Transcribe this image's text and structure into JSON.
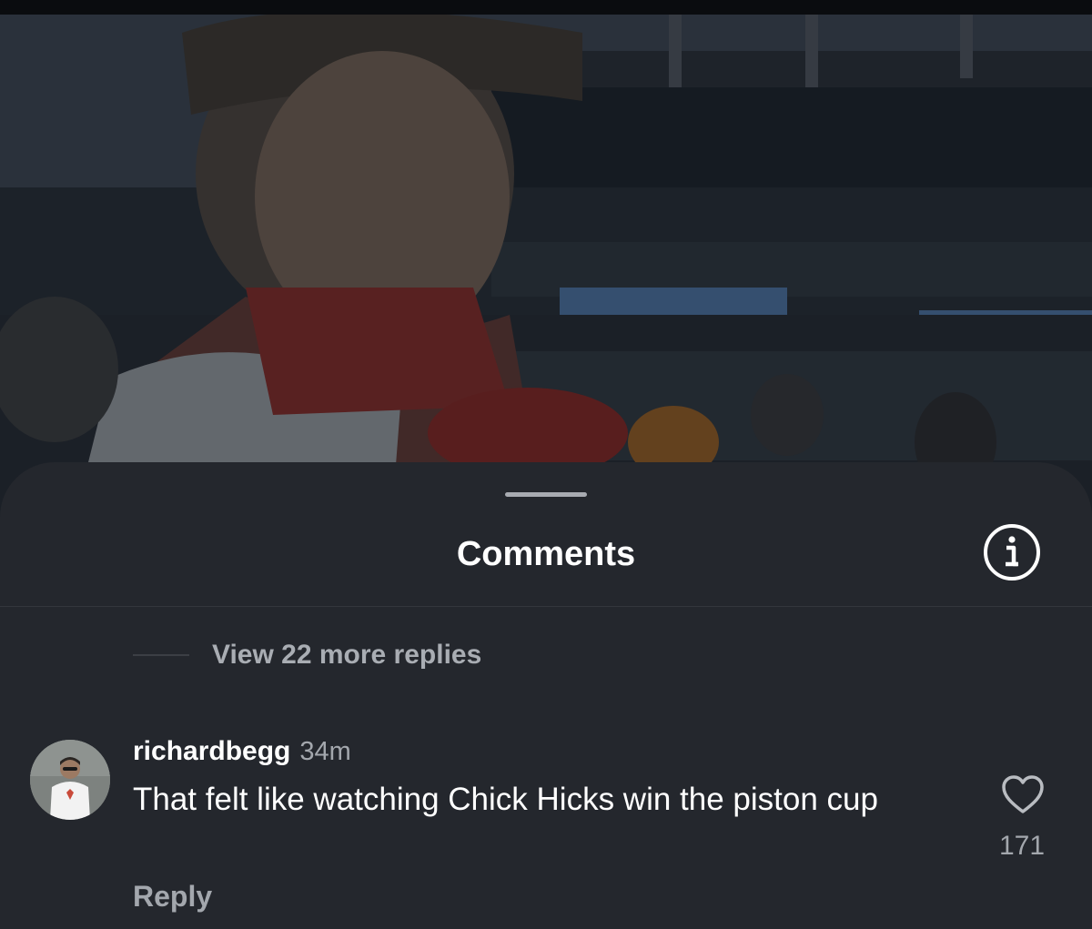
{
  "sheet": {
    "title": "Comments",
    "info_icon": "info-circle-icon"
  },
  "thread": {
    "more_replies_label": "View 22 more replies"
  },
  "comment": {
    "username": "richardbegg",
    "timestamp": "34m",
    "text": "That felt like watching Chick Hicks win the piston cup",
    "like_icon": "heart-outline-icon",
    "like_count": "171",
    "reply_label": "Reply"
  },
  "colors": {
    "sheet_background": "#24272d",
    "primary_text": "#ffffff",
    "secondary_text": "#a3a7ad"
  }
}
